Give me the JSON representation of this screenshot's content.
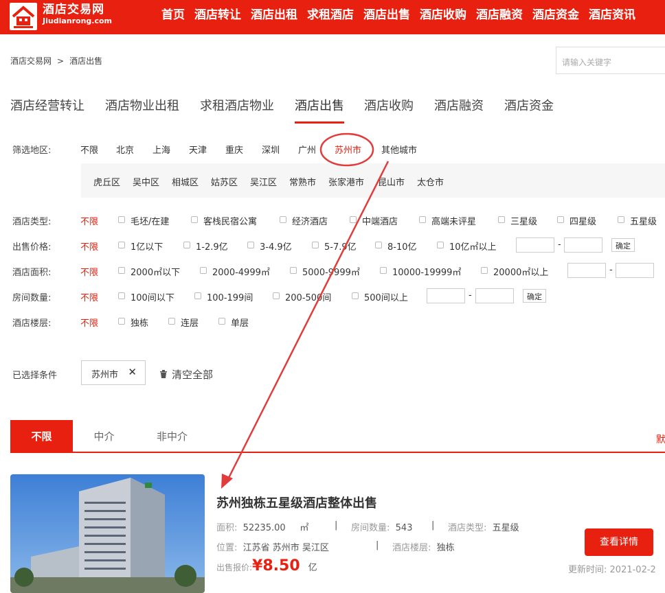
{
  "brand": {
    "name": "酒店交易网",
    "domain": "Jiudianrong.com"
  },
  "nav": [
    "首页",
    "酒店转让",
    "酒店出租",
    "求租酒店",
    "酒店出售",
    "酒店收购",
    "酒店融资",
    "酒店资金",
    "酒店资讯"
  ],
  "breadcrumb": {
    "home": "酒店交易网",
    "sep": ">",
    "current": "酒店出售"
  },
  "search": {
    "placeholder": "请输入关键字"
  },
  "tabs": [
    "酒店经营转让",
    "酒店物业出租",
    "求租酒店物业",
    "酒店出售",
    "酒店收购",
    "酒店融资",
    "酒店资金"
  ],
  "filters": {
    "region_label": "筛选地区:",
    "regions": [
      "不限",
      "北京",
      "上海",
      "天津",
      "重庆",
      "深圳",
      "广州",
      "苏州市",
      "其他城市"
    ],
    "districts": [
      "虎丘区",
      "吴中区",
      "相城区",
      "姑苏区",
      "吴江区",
      "常熟市",
      "张家港市",
      "昆山市",
      "太仓市"
    ],
    "type_label": "酒店类型:",
    "types": [
      "毛坯/在建",
      "客栈民宿公寓",
      "经济酒店",
      "中端酒店",
      "高端未评星",
      "三星级",
      "四星级",
      "五星级"
    ],
    "price_label": "出售价格:",
    "prices": [
      "1亿以下",
      "1-2.9亿",
      "3-4.9亿",
      "5-7.9亿",
      "8-10亿",
      "10亿㎡以上"
    ],
    "area_label": "酒店面积:",
    "areas": [
      "2000㎡以下",
      "2000-4999㎡",
      "5000-9999㎡",
      "10000-19999㎡",
      "20000㎡以上"
    ],
    "rooms_label": "房间数量:",
    "rooms": [
      "100间以下",
      "100-199间",
      "200-500间",
      "500间以上"
    ],
    "floor_label": "酒店楼层:",
    "floors": [
      "独栋",
      "连层",
      "单层"
    ],
    "any": "不限",
    "confirm": "确定",
    "dash": "-"
  },
  "selected": {
    "label": "已选择条件",
    "chip": "苏州市",
    "clear": "清空全部"
  },
  "agent_tabs": [
    "不限",
    "中介",
    "非中介"
  ],
  "sort_label": "默",
  "listing": {
    "title": "苏州独栋五星级酒店整体出售",
    "area_label": "面积:",
    "area": "52235.00",
    "area_unit": "㎡",
    "rooms_label": "房间数量:",
    "rooms": "543",
    "type_label": "酒店类型:",
    "type": "五星级",
    "location_label": "位置:",
    "location": "江苏省 苏州市 吴江区",
    "floor_label": "酒店楼层:",
    "floor": "独栋",
    "price_label": "出售报价:",
    "price": "¥8.50",
    "price_unit": "亿",
    "detail_btn": "查看详情",
    "updated_label": "更新时间:",
    "updated": "2021-02-2"
  },
  "colors": {
    "brand": "#e8200f"
  }
}
